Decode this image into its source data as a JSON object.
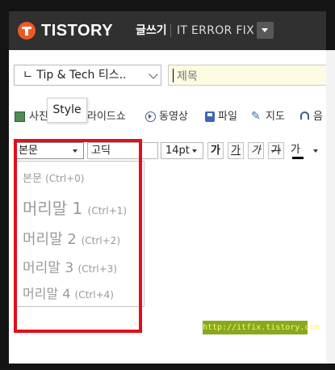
{
  "header": {
    "brand": "TISTORY",
    "write_label": "글쓰기",
    "blog_name": "IT ERROR FIX"
  },
  "editor": {
    "category": "ㄴ Tip & Tech 티스..",
    "title_placeholder": "제목"
  },
  "insert_toolbar": {
    "items": [
      {
        "label": "사진",
        "icon": "photo-icon"
      },
      {
        "label": "슬라이드쇼",
        "visible_label": "라이드쇼"
      },
      {
        "label": "동영상",
        "icon": "video-icon"
      },
      {
        "label": "파일",
        "icon": "file-icon"
      },
      {
        "label": "지도",
        "icon": "map-icon"
      },
      {
        "label": "음",
        "icon": "music-icon"
      }
    ],
    "tooltip": "Style"
  },
  "format_toolbar": {
    "style_value": "본문",
    "font_value": "고딕",
    "size_value": "14pt",
    "bold": "가",
    "underline": "가",
    "italic": "가",
    "strike": "가",
    "color": "가"
  },
  "style_dropdown": {
    "items": [
      {
        "label": "본문",
        "shortcut": "(Ctrl+0)"
      },
      {
        "label": "머리말 1",
        "shortcut": "(Ctrl+1)"
      },
      {
        "label": "머리말 2",
        "shortcut": "(Ctrl+2)"
      },
      {
        "label": "머리말 3",
        "shortcut": "(Ctrl+3)"
      },
      {
        "label": "머리말 4",
        "shortcut": "(Ctrl+4)"
      }
    ]
  },
  "watermark": "http://itfix.tistory.com",
  "colors": {
    "topbar": "#303030",
    "brand_orange": "#ee5a24",
    "highlight_red": "#e10f1b",
    "watermark_green": "#86a920"
  }
}
